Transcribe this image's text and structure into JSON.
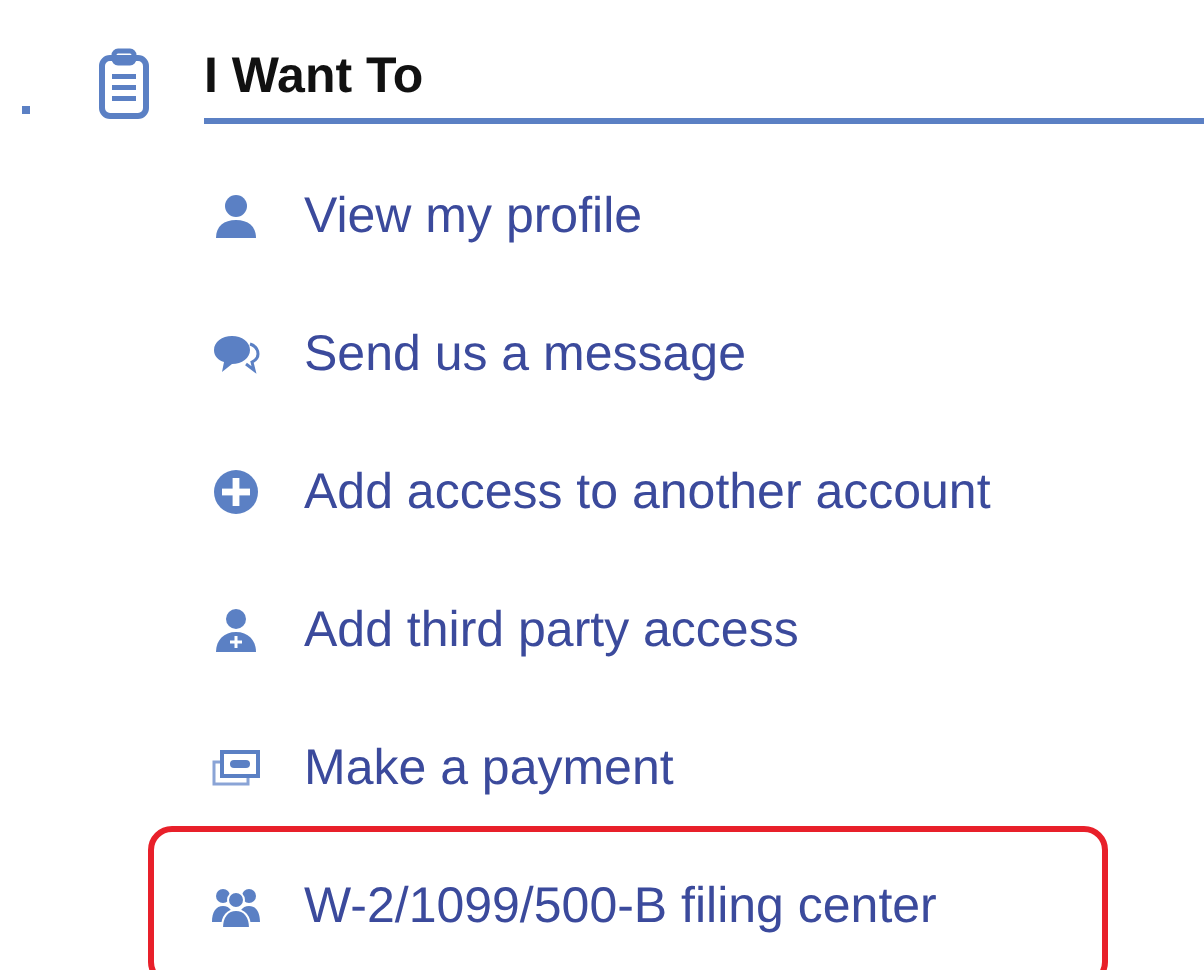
{
  "panel": {
    "title": "I Want To"
  },
  "items": [
    {
      "label": "View my profile",
      "highlighted": false
    },
    {
      "label": "Send us a message",
      "highlighted": false
    },
    {
      "label": "Add access to another account",
      "highlighted": false
    },
    {
      "label": "Add third party access",
      "highlighted": false
    },
    {
      "label": "Make a payment",
      "highlighted": false
    },
    {
      "label": "W-2/1099/500-B filing center",
      "highlighted": true
    }
  ]
}
